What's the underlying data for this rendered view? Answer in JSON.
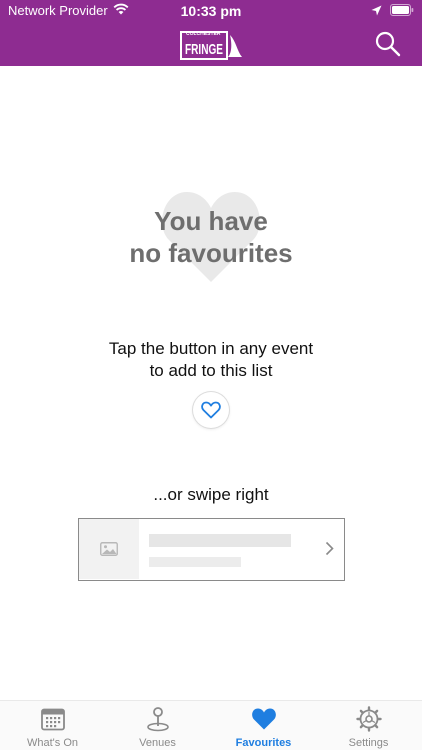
{
  "status": {
    "carrier": "Network Provider",
    "time": "10:33 pm"
  },
  "header": {
    "logo_small": "COLCHESTER",
    "logo_main": "FRINGE"
  },
  "empty_state": {
    "title_line1": "You have",
    "title_line2": "no favourites",
    "tap_line1": "Tap the button in any event",
    "tap_line2": "to add to this list",
    "swipe_text": "...or swipe right"
  },
  "tabs": [
    {
      "label": "What's On",
      "icon": "calendar-icon",
      "active": false
    },
    {
      "label": "Venues",
      "icon": "map-pin-icon",
      "active": false
    },
    {
      "label": "Favourites",
      "icon": "heart-icon",
      "active": true
    },
    {
      "label": "Settings",
      "icon": "gear-icon",
      "active": false
    }
  ],
  "colors": {
    "brand": "#8e2c91",
    "accent": "#1f7ee0",
    "inactive": "#8a8a8a"
  }
}
